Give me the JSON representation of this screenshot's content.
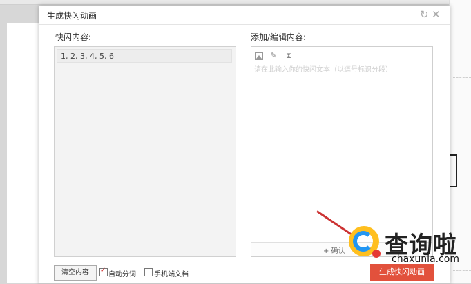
{
  "dialog": {
    "title": "生成快闪动画",
    "refresh_icon": "refresh-icon",
    "close_icon": "close-icon"
  },
  "left": {
    "label": "快闪内容:",
    "items": [
      "1, 2, 3, 4, 5, 6"
    ]
  },
  "right": {
    "label": "添加/编辑内容:",
    "toolbar": [
      "image-icon",
      "pen-icon",
      "hourglass-icon"
    ],
    "placeholder": "请在此输入你的快闪文本（以逗号标识分段）",
    "confirm_label": "+ 确认"
  },
  "footer": {
    "clear_label": "清空内容",
    "auto_split_label": "自动分词",
    "auto_split_checked": true,
    "mobile_doc_label": "手机端文档",
    "mobile_doc_checked": false,
    "generate_label": "生成快闪动画"
  },
  "watermark": {
    "title": "查询啦",
    "subtitle": "chaxunla.com"
  },
  "colors": {
    "accent": "#e2513c",
    "arrow": "#cc3333",
    "wm_yellow": "#ffbf1f",
    "wm_blue": "#2196f3",
    "wm_red": "#e53935"
  }
}
